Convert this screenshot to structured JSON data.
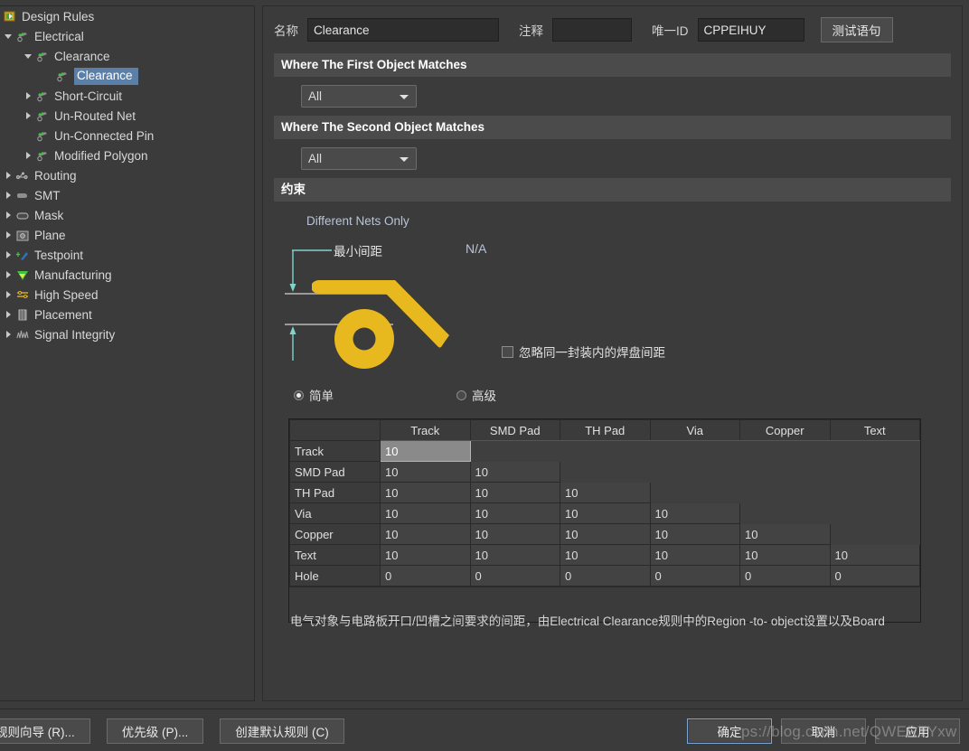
{
  "tree": {
    "root": {
      "label": "Design Rules",
      "icon": "design-rules-icon"
    },
    "items": [
      {
        "label": "Electrical",
        "depth": 1,
        "twisty": "open",
        "icon": "electrical-icon",
        "selected": false
      },
      {
        "label": "Clearance",
        "depth": 2,
        "twisty": "open",
        "icon": "rule-group-icon",
        "selected": false
      },
      {
        "label": "Clearance",
        "depth": 3,
        "twisty": "none",
        "icon": "rule-icon",
        "selected": true
      },
      {
        "label": "Short-Circuit",
        "depth": 2,
        "twisty": "closed",
        "icon": "rule-group-icon",
        "selected": false
      },
      {
        "label": "Un-Routed Net",
        "depth": 2,
        "twisty": "closed",
        "icon": "rule-group-icon",
        "selected": false
      },
      {
        "label": "Un-Connected Pin",
        "depth": 2,
        "twisty": "none",
        "icon": "rule-group-icon",
        "selected": false
      },
      {
        "label": "Modified Polygon",
        "depth": 2,
        "twisty": "closed",
        "icon": "rule-group-icon",
        "selected": false
      },
      {
        "label": "Routing",
        "depth": 1,
        "twisty": "closed",
        "icon": "routing-icon",
        "selected": false
      },
      {
        "label": "SMT",
        "depth": 1,
        "twisty": "closed",
        "icon": "smt-icon",
        "selected": false
      },
      {
        "label": "Mask",
        "depth": 1,
        "twisty": "closed",
        "icon": "mask-icon",
        "selected": false
      },
      {
        "label": "Plane",
        "depth": 1,
        "twisty": "closed",
        "icon": "plane-icon",
        "selected": false
      },
      {
        "label": "Testpoint",
        "depth": 1,
        "twisty": "closed",
        "icon": "testpoint-icon",
        "selected": false
      },
      {
        "label": "Manufacturing",
        "depth": 1,
        "twisty": "closed",
        "icon": "manufacturing-icon",
        "selected": false
      },
      {
        "label": "High Speed",
        "depth": 1,
        "twisty": "closed",
        "icon": "high-speed-icon",
        "selected": false
      },
      {
        "label": "Placement",
        "depth": 1,
        "twisty": "closed",
        "icon": "placement-icon",
        "selected": false
      },
      {
        "label": "Signal Integrity",
        "depth": 1,
        "twisty": "closed",
        "icon": "signal-integrity-icon",
        "selected": false
      }
    ]
  },
  "header": {
    "name_label": "名称",
    "name_value": "Clearance",
    "comment_label": "注释",
    "comment_value": "",
    "uid_label": "唯一ID",
    "uid_value": "CPPEIHUY",
    "test_button": "测试语句"
  },
  "sections": {
    "first_object": {
      "title": "Where The First Object Matches",
      "scope_value": "All"
    },
    "second_object": {
      "title": "Where The Second Object Matches",
      "scope_value": "All"
    },
    "constraint": {
      "title": "约束"
    }
  },
  "constraint": {
    "different_nets_only": "Different Nets Only",
    "min_gap_label": "最小间距",
    "min_gap_value": "N/A",
    "ignore_pad_label": "忽略同一封装内的焊盘间距",
    "ignore_pad_checked": false,
    "mode_simple": "简单",
    "mode_advanced": "高级",
    "mode_selected": "简单"
  },
  "matrix": {
    "columns": [
      "Track",
      "SMD Pad",
      "TH Pad",
      "Via",
      "Copper",
      "Text"
    ],
    "rows": [
      {
        "label": "Track",
        "values": [
          "10"
        ]
      },
      {
        "label": "SMD Pad",
        "values": [
          "10",
          "10"
        ]
      },
      {
        "label": "TH Pad",
        "values": [
          "10",
          "10",
          "10"
        ]
      },
      {
        "label": "Via",
        "values": [
          "10",
          "10",
          "10",
          "10"
        ]
      },
      {
        "label": "Copper",
        "values": [
          "10",
          "10",
          "10",
          "10",
          "10"
        ]
      },
      {
        "label": "Text",
        "values": [
          "10",
          "10",
          "10",
          "10",
          "10",
          "10"
        ]
      },
      {
        "label": "Hole",
        "values": [
          "0",
          "0",
          "0",
          "0",
          "0",
          "0"
        ]
      }
    ],
    "selected_cell": {
      "row": 0,
      "col": 0
    }
  },
  "description": "电气对象与电路板开口/凹槽之间要求的间距，由Electrical Clearance规则中的Region -to- object设置以及Board",
  "bottom_bar": {
    "left_buttons": [
      "规则向导 (R)...",
      "优先级 (P)...",
      "创建默认规则 (C)"
    ],
    "right_buttons": [
      "确定",
      "取消",
      "应用"
    ]
  },
  "watermark": "ps://blog.csdn.net/QWERTYxw",
  "colors": {
    "window_bg": "#3b3b3b",
    "section_header_bg": "#4b4b4b",
    "selection_blue": "#5b7fa6",
    "graphic_yellow": "#e8b81f",
    "dimension_teal": "#7fd4cc",
    "accent_text": "#b9c4d6"
  }
}
